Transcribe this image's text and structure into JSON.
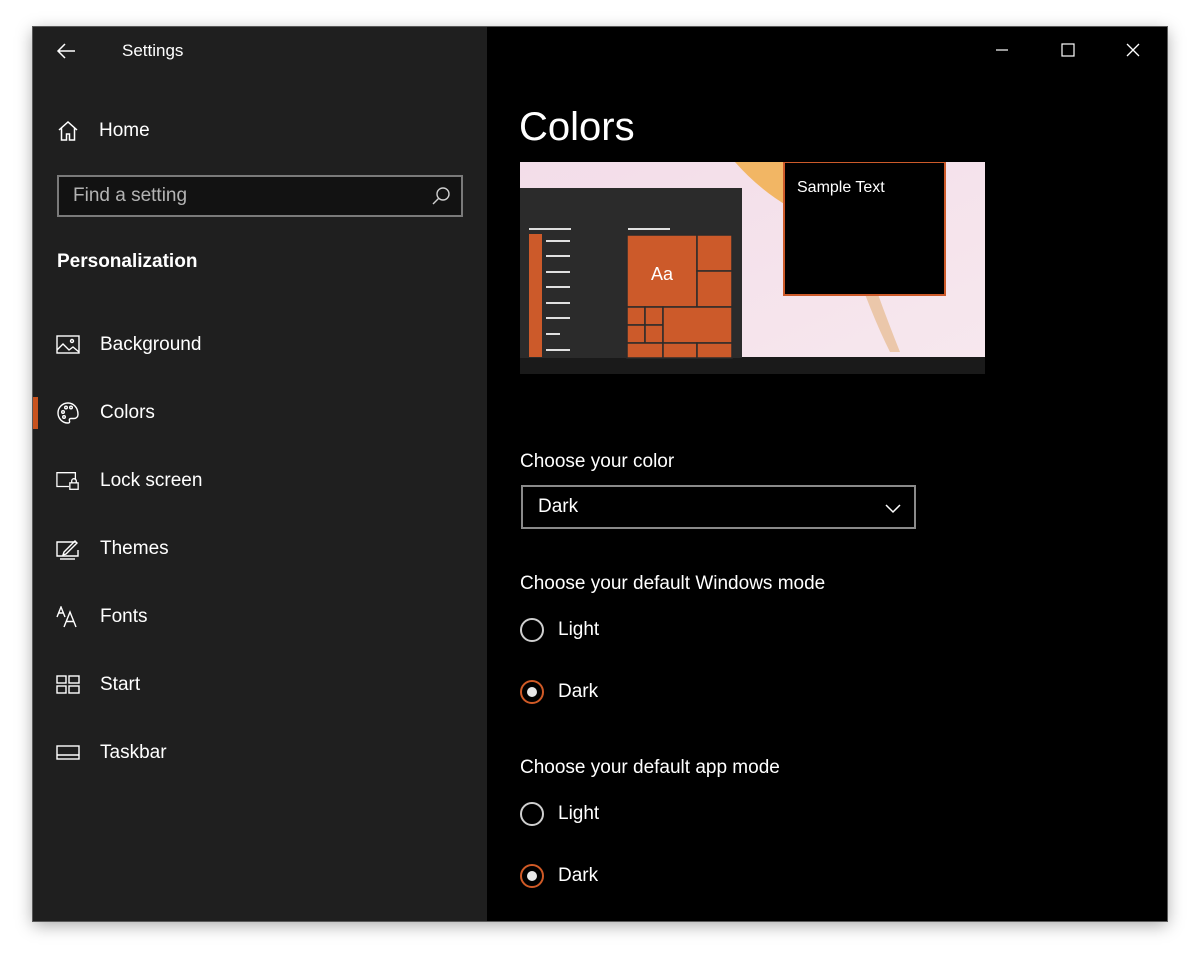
{
  "window": {
    "title": "Settings"
  },
  "sidebar": {
    "home_label": "Home",
    "search_placeholder": "Find a setting",
    "section_heading": "Personalization",
    "items": [
      {
        "label": "Background",
        "icon": "image-icon"
      },
      {
        "label": "Colors",
        "icon": "palette-icon",
        "selected": true
      },
      {
        "label": "Lock screen",
        "icon": "lock-screen-icon"
      },
      {
        "label": "Themes",
        "icon": "themes-icon"
      },
      {
        "label": "Fonts",
        "icon": "fonts-icon"
      },
      {
        "label": "Start",
        "icon": "start-icon"
      },
      {
        "label": "Taskbar",
        "icon": "taskbar-icon"
      }
    ]
  },
  "main": {
    "title": "Colors",
    "preview": {
      "sample_text": "Sample Text",
      "tile_text": "Aa"
    },
    "choose_color": {
      "label": "Choose your color",
      "value": "Dark"
    },
    "windows_mode": {
      "label": "Choose your default Windows mode",
      "options": [
        {
          "label": "Light",
          "checked": false
        },
        {
          "label": "Dark",
          "checked": true
        }
      ]
    },
    "app_mode": {
      "label": "Choose your default app mode",
      "options": [
        {
          "label": "Light",
          "checked": false
        },
        {
          "label": "Dark",
          "checked": true
        }
      ]
    }
  },
  "colors": {
    "accent": "#c8531f",
    "sidebar_bg": "#1f1f1f",
    "content_bg": "#000000"
  }
}
